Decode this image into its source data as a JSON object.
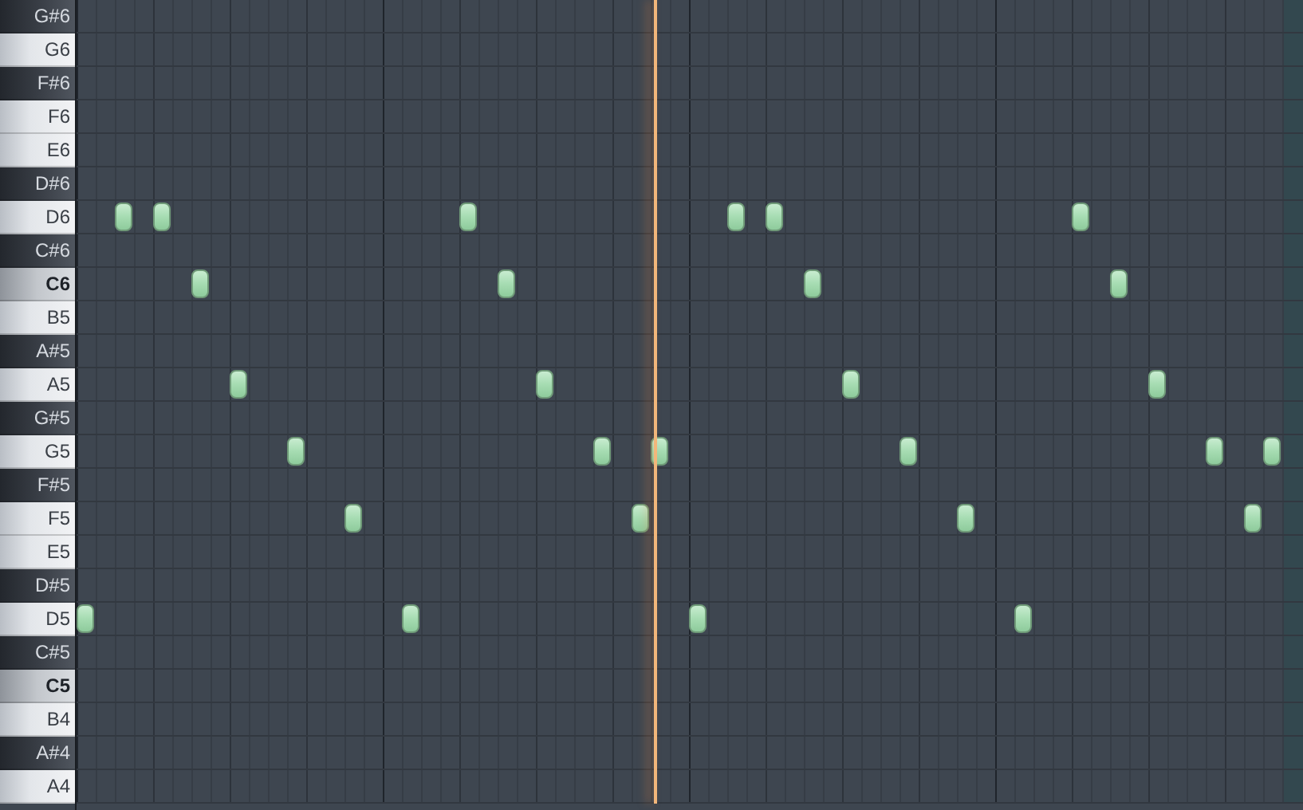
{
  "rows": [
    {
      "label": "G#6",
      "kind": "black"
    },
    {
      "label": "G6",
      "kind": "white"
    },
    {
      "label": "F#6",
      "kind": "black"
    },
    {
      "label": "F6",
      "kind": "white"
    },
    {
      "label": "E6",
      "kind": "white"
    },
    {
      "label": "D#6",
      "kind": "black"
    },
    {
      "label": "D6",
      "kind": "white",
      "notes": [
        {
          "level": 0.03125
        },
        {
          "level": 0.0625
        },
        {
          "level": 0.3125
        },
        {
          "level": 0.53125
        },
        {
          "level": 0.5625
        },
        {
          "level": 0.8125
        }
      ]
    },
    {
      "label": "C#6",
      "kind": "black"
    },
    {
      "label": "C6",
      "kind": "c",
      "notes": [
        {
          "level": 0.09375
        },
        {
          "level": 0.34375
        },
        {
          "level": 0.59375
        },
        {
          "level": 0.84375
        }
      ]
    },
    {
      "label": "B5",
      "kind": "white"
    },
    {
      "label": "A#5",
      "kind": "black"
    },
    {
      "label": "A5",
      "kind": "white",
      "notes": [
        {
          "level": 0.125
        },
        {
          "level": 0.375
        },
        {
          "level": 0.625
        },
        {
          "level": 0.875
        }
      ]
    },
    {
      "label": "G#5",
      "kind": "black"
    },
    {
      "label": "G5",
      "kind": "white",
      "notes": [
        {
          "level": 0.171875
        },
        {
          "level": 0.421875
        },
        {
          "level": 0.46875
        },
        {
          "level": 0.671875
        },
        {
          "level": 0.921875
        },
        {
          "level": 0.96875
        }
      ]
    },
    {
      "label": "F#5",
      "kind": "black"
    },
    {
      "label": "F5",
      "kind": "white",
      "notes": [
        {
          "level": 0.21875
        },
        {
          "level": 0.453125
        },
        {
          "level": 0.71875
        },
        {
          "level": 0.953125
        }
      ]
    },
    {
      "label": "E5",
      "kind": "white"
    },
    {
      "label": "D#5",
      "kind": "black"
    },
    {
      "label": "D5",
      "kind": "white",
      "notes": [
        {
          "level": 0
        },
        {
          "level": 0.265625
        },
        {
          "level": 0.5
        },
        {
          "level": 0.765625
        }
      ]
    },
    {
      "label": "C#5",
      "kind": "black"
    },
    {
      "label": "C5",
      "kind": "c"
    },
    {
      "label": "B4",
      "kind": "white"
    },
    {
      "label": "A#4",
      "kind": "black"
    },
    {
      "label": "A4",
      "kind": "white"
    }
  ],
  "playhead": {
    "level": 0.4727
  }
}
